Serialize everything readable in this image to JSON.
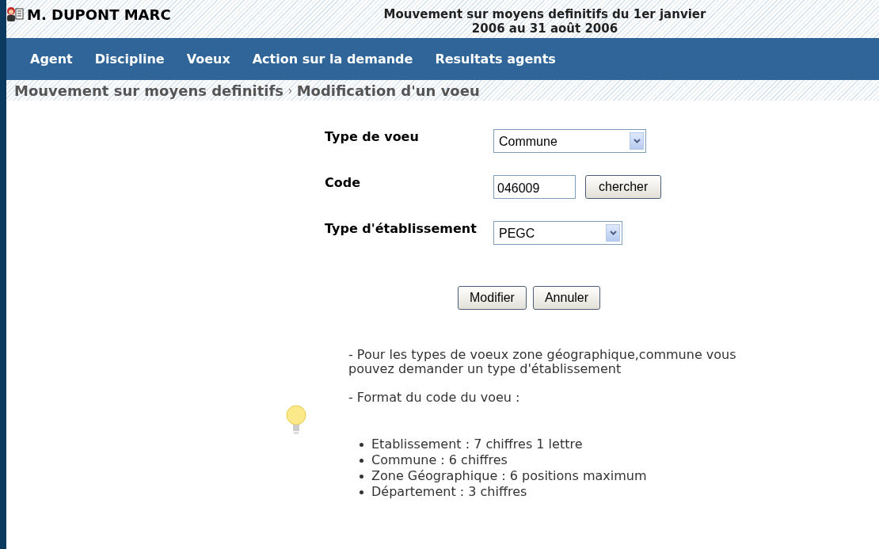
{
  "header": {
    "user": "M. DUPONT MARC",
    "title_lines": [
      "Mouvement sur moyens definitifs du 1er janvier",
      "2006 au 31 août 2006"
    ]
  },
  "nav": [
    "Agent",
    "Discipline",
    "Voeux",
    "Action sur la demande",
    "Resultats agents"
  ],
  "breadcrumb": {
    "items": [
      "Mouvement sur moyens definitifs",
      "Modification d'un voeu"
    ],
    "separator": "›"
  },
  "form": [
    {
      "kind": "select",
      "label": "Type de voeu",
      "value": "Commune"
    },
    {
      "kind": "input",
      "label": "Code",
      "value": "046009",
      "button": "chercher"
    },
    {
      "kind": "select",
      "label": "Type d'établissement",
      "value": "PEGC"
    }
  ],
  "buttons": [
    "Modifier",
    "Annuler"
  ],
  "help": {
    "paragraphs": [
      "- Pour les types de voeux zone géographique,commune vous pouvez demander un type d'établissement",
      "- Format du code du voeu :"
    ],
    "list": [
      "Etablissement : 7 chiffres 1 lettre",
      "Commune : 6 chiffres",
      "Zone Géographique : 6 positions maximum",
      "Département : 3 chiffres"
    ]
  }
}
